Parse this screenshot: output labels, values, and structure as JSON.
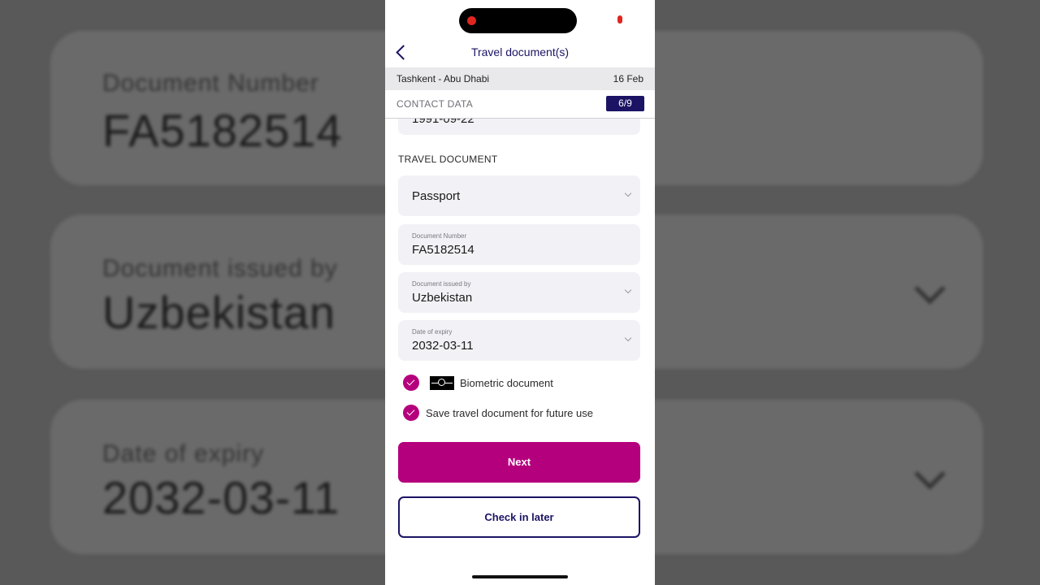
{
  "background": {
    "cards": [
      {
        "label": "Document Number",
        "value": "FA5182514",
        "has_chevron": false
      },
      {
        "label": "Document issued by",
        "value": "Uzbekistan",
        "has_chevron": true
      },
      {
        "label": "Date of expiry",
        "value": "2032-03-11",
        "has_chevron": true
      }
    ]
  },
  "header": {
    "title": "Travel document(s)",
    "back_icon": "chevron-left-icon"
  },
  "route": {
    "from_to": "Tashkent - Abu Dhabi",
    "date": "16 Feb"
  },
  "section": {
    "label": "CONTACT DATA",
    "step": "6/9"
  },
  "contact": {
    "date_of_birth": "1991-09-22"
  },
  "travel_document": {
    "heading": "TRAVEL DOCUMENT",
    "type": "Passport",
    "number_label": "Document Number",
    "number_value": "FA5182514",
    "issued_by_label": "Document issued by",
    "issued_by_value": "Uzbekistan",
    "expiry_label": "Date of expiry",
    "expiry_value": "2032-03-11"
  },
  "checkboxes": {
    "biometric": {
      "label": "Biometric document",
      "checked": true
    },
    "save": {
      "label": "Save travel document for future use",
      "checked": true
    }
  },
  "buttons": {
    "next": "Next",
    "later": "Check in later"
  },
  "colors": {
    "primary": "#b5007d",
    "navy": "#1b1464"
  }
}
